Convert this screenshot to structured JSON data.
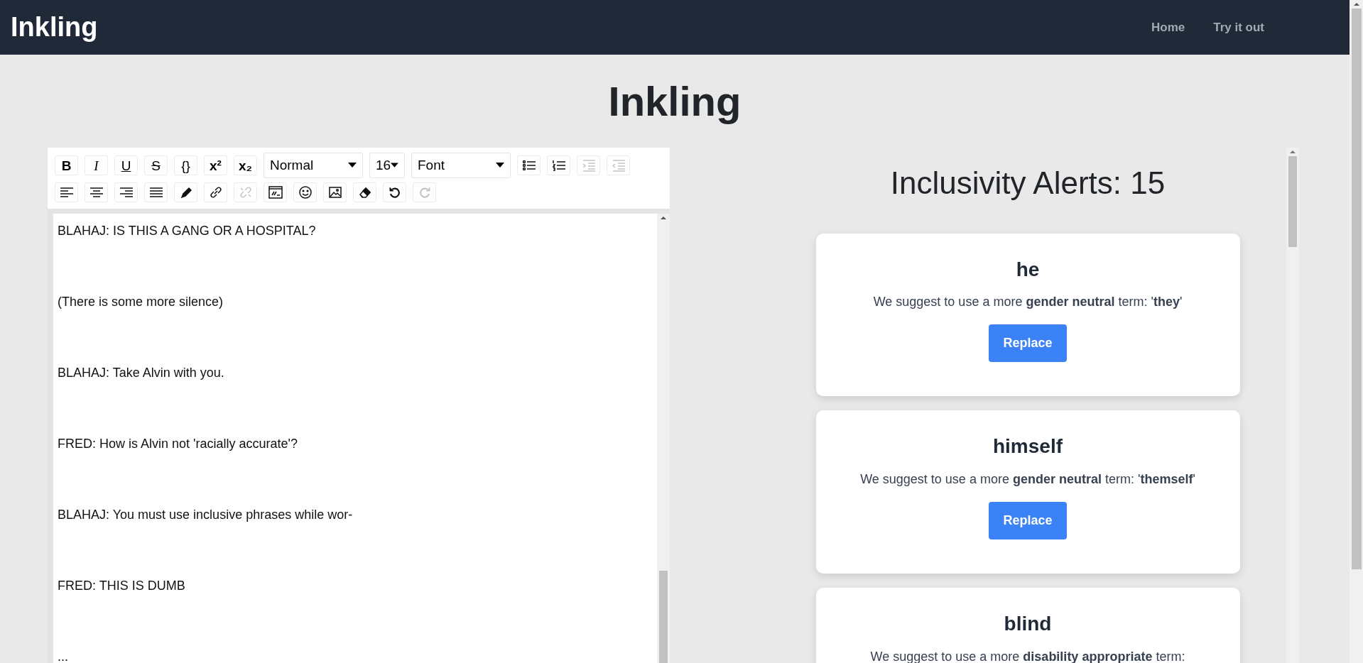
{
  "navbar": {
    "brand": "Inkling",
    "links": [
      "Home",
      "Try it out"
    ]
  },
  "page_title": "Inkling",
  "editor": {
    "toolbar": [
      [
        {
          "kind": "glyph",
          "label": "B"
        },
        {
          "kind": "glyph",
          "label": "I"
        },
        {
          "kind": "glyph",
          "label": "U"
        },
        {
          "kind": "glyph",
          "label": "S"
        },
        {
          "kind": "glyph",
          "label": "{}"
        },
        {
          "kind": "glyph",
          "label": "x²"
        },
        {
          "kind": "glyph",
          "label": "x₂"
        },
        {
          "kind": "dropdown",
          "value": "Normal"
        },
        {
          "kind": "dropdown",
          "value": "16"
        },
        {
          "kind": "dropdown",
          "value": "Font"
        },
        {
          "kind": "icon",
          "disabled": false
        },
        {
          "kind": "icon",
          "disabled": false
        },
        {
          "kind": "icon",
          "disabled": true
        },
        {
          "kind": "icon",
          "disabled": true
        }
      ],
      [
        {
          "kind": "icon",
          "disabled": false
        },
        {
          "kind": "icon",
          "disabled": false
        },
        {
          "kind": "icon",
          "disabled": false
        },
        {
          "kind": "icon",
          "disabled": false
        },
        {
          "kind": "icon",
          "disabled": false
        },
        {
          "kind": "icon",
          "disabled": false
        },
        {
          "kind": "icon",
          "disabled": true
        },
        {
          "kind": "icon",
          "disabled": false
        },
        {
          "kind": "icon",
          "disabled": false
        },
        {
          "kind": "icon",
          "disabled": false
        },
        {
          "kind": "icon",
          "disabled": false
        },
        {
          "kind": "icon",
          "disabled": false
        },
        {
          "kind": "icon",
          "disabled": true
        }
      ]
    ],
    "lines": [
      "BLAHAJ: IS THIS A GANG OR A HOSPITAL?",
      "(There is some more silence)",
      "BLAHAJ: Take Alvin with you.",
      "FRED: How is Alvin not 'racially accurate'?",
      "BLAHAJ: You must use inclusive phrases while wor-",
      "FRED: THIS IS DUMB",
      "..."
    ]
  },
  "alerts": {
    "heading": "Inclusivity Alerts: 15",
    "cards": [
      {
        "term": "he",
        "suggestion": "We suggest to use a more **gender neutral** term: '**they**'",
        "button": "Replace"
      },
      {
        "term": "himself",
        "suggestion": "We suggest to use a more **gender neutral** term: '**themself**'",
        "button": "Replace"
      },
      {
        "term": "blind",
        "suggestion": "We suggest to use a more **disability appropriate** term:"
      }
    ]
  }
}
